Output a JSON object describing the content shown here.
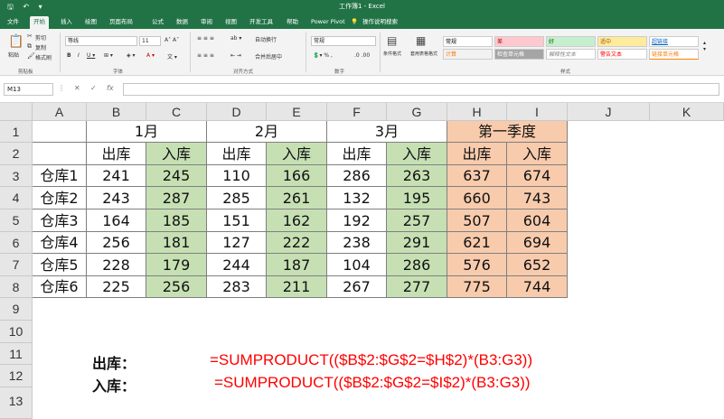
{
  "titlebar": {
    "title": "工作簿1 - Excel",
    "quick_access": "🖫 ↶ ▾"
  },
  "tabs": [
    "文件",
    "开始",
    "插入",
    "绘图",
    "页面布局",
    "公式",
    "数据",
    "审阅",
    "视图",
    "开发工具",
    "帮助",
    "Power Pivot",
    "操作说明搜索"
  ],
  "active_tab": "开始",
  "ribbon": {
    "clipboard": {
      "paste": "粘贴",
      "cut": "剪切",
      "copy": "复制",
      "format_painter": "格式刷",
      "group": "剪贴板"
    },
    "font": {
      "name": "等线",
      "size": "11",
      "group": "字体"
    },
    "alignment": {
      "wrap": "自动换行",
      "merge": "合并后居中",
      "group": "对齐方式"
    },
    "number": {
      "format": "常规",
      "group": "数字"
    },
    "styles": {
      "conditional": "条件格式",
      "table": "套用表格格式",
      "cells": [
        "常规",
        "差",
        "好",
        "适中",
        "超链接",
        "计算",
        "检查单元格",
        "解释性文本",
        "警告文本",
        "链接单元格"
      ],
      "group": "样式"
    }
  },
  "formula_bar": {
    "name_box": "M13",
    "cancel": "✕",
    "enter": "✓",
    "fx": "fx",
    "value": ""
  },
  "columns": [
    "A",
    "B",
    "C",
    "D",
    "E",
    "F",
    "G",
    "H",
    "I",
    "J",
    "K"
  ],
  "rows": [
    "1",
    "2",
    "3",
    "4",
    "5",
    "6",
    "7",
    "8",
    "9",
    "10",
    "11",
    "12",
    "13"
  ],
  "sheet": {
    "months": [
      "1月",
      "2月",
      "3月",
      "第一季度"
    ],
    "subheaders": [
      "出库",
      "入库",
      "出库",
      "入库",
      "出库",
      "入库",
      "出库",
      "入库"
    ],
    "warehouses": [
      {
        "name": "仓库1",
        "values": [
          "241",
          "245",
          "110",
          "166",
          "286",
          "263",
          "637",
          "674"
        ]
      },
      {
        "name": "仓库2",
        "values": [
          "243",
          "287",
          "285",
          "261",
          "132",
          "195",
          "660",
          "743"
        ]
      },
      {
        "name": "仓库3",
        "values": [
          "164",
          "185",
          "151",
          "162",
          "192",
          "257",
          "507",
          "604"
        ]
      },
      {
        "name": "仓库4",
        "values": [
          "256",
          "181",
          "127",
          "222",
          "238",
          "291",
          "621",
          "694"
        ]
      },
      {
        "name": "仓库5",
        "values": [
          "228",
          "179",
          "244",
          "187",
          "104",
          "286",
          "576",
          "652"
        ]
      },
      {
        "name": "仓库6",
        "values": [
          "225",
          "256",
          "283",
          "211",
          "267",
          "277",
          "775",
          "744"
        ]
      }
    ],
    "label_out": "出库：",
    "label_in": "入库：",
    "formula_out": "=SUMPRODUCT(($B$2:$G$2=$H$2)*(B3:G3))",
    "formula_in": "=SUMPRODUCT(($B$2:$G$2=$I$2)*(B3:G3))"
  },
  "colors": {
    "brand": "#217346",
    "green_fill": "#c6e0b4",
    "peach_fill": "#f8cbad",
    "formula_text": "#ff0000"
  }
}
